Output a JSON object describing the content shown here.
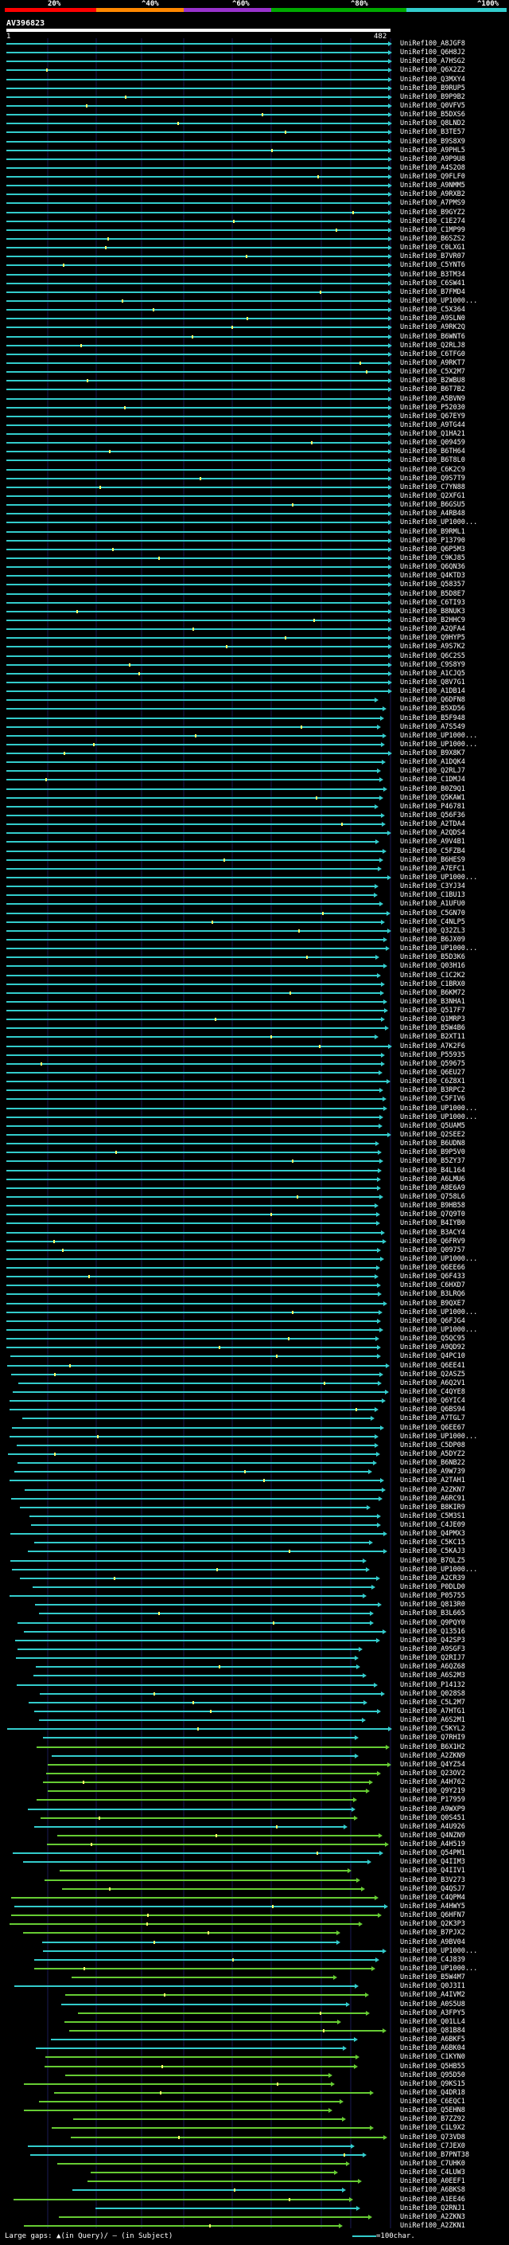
{
  "scale": {
    "ticks": [
      "20%",
      "^40%",
      "^60%",
      "^80%",
      "^100%"
    ],
    "segment_colors": [
      "#ff0000",
      "#ff8800",
      "#9933cc",
      "#00aa00",
      "#33cccc"
    ]
  },
  "query": {
    "id": "AV396823",
    "start": "1",
    "end": "482"
  },
  "hit_colors": {
    "cyan": "#33cccc",
    "green": "#66cc33"
  },
  "hits": [
    "UniRef100_A8JGF8",
    "UniRef100_Q6H8J2",
    "UniRef100_A7HSG2",
    "UniRef100_Q6X2Z2",
    "UniRef100_Q3MXY4",
    "UniRef100_B9RUP5",
    "UniRef100_B9P9B2",
    "UniRef100_Q0VFV5",
    "UniRef100_B5DXS6",
    "UniRef100_Q8LND2",
    "UniRef100_B3TE57",
    "UniRef100_B9S8X9",
    "UniRef100_A9PHL5",
    "UniRef100_A9P9U8",
    "UniRef100_A4S2O8",
    "UniRef100_Q9FLF0",
    "UniRef100_A9NMM5",
    "UniRef100_A9RXB2",
    "UniRef100_A7PMS9",
    "UniRef100_B9GYZ2",
    "UniRef100_C1E274",
    "UniRef100_C1MP99",
    "UniRef100_B6SZS2",
    "UniRef100_C0LXG1",
    "UniRef100_B7VR07",
    "UniRef100_C5YNT6",
    "UniRef100_B3TM34",
    "UniRef100_C6SW41",
    "UniRef100_B7FMD4",
    "UniRef100_UP1000...",
    "UniRef100_C5X364",
    "UniRef100_A9SLN0",
    "UniRef100_A9RK2Q",
    "UniRef100_B6WNT6",
    "UniRef100_Q2RLJ8",
    "UniRef100_C6TFG0",
    "UniRef100_A9RKT7",
    "UniRef100_C5X2M7",
    "UniRef100_B2WBU8",
    "UniRef100_B6T7B2",
    "UniRef100_A5BVN9",
    "UniRef100_P52030",
    "UniRef100_Q67EY9",
    "UniRef100_A9TG44",
    "UniRef100_Q1HA21",
    "UniRef100_Q09459",
    "UniRef100_B6TH64",
    "UniRef100_B6T8L0",
    "UniRef100_C6K2C9",
    "UniRef100_Q9S7T9",
    "UniRef100_C7YN88",
    "UniRef100_Q2XFG1",
    "UniRef100_B6GSU5",
    "UniRef100_A4RB48",
    "UniRef100_UP1000...",
    "UniRef100_B9RML1",
    "UniRef100_P13790",
    "UniRef100_Q6P5M3",
    "UniRef100_C9KJ85",
    "UniRef100_Q6QN36",
    "UniRef100_Q4KTD3",
    "UniRef100_Q58357",
    "UniRef100_B5D8E7",
    "UniRef100_C6TI93",
    "UniRef100_B8NUK3",
    "UniRef100_B2HHC9",
    "UniRef100_A2QFA4",
    "UniRef100_Q9HYP5",
    "UniRef100_A9S7K2",
    "UniRef100_Q6C2S5",
    "UniRef100_C9S8Y9",
    "UniRef100_A1CJQ5",
    "UniRef100_Q8V7G1",
    "UniRef100_A1DB14",
    "UniRef100_Q6DFN8",
    "UniRef100_B5XD56",
    "UniRef100_B5F948",
    "UniRef100_A7S549",
    "UniRef100_UP1000...",
    "UniRef100_UP1000...",
    "UniRef100_B9X8K7",
    "UniRef100_A1DQK4",
    "UniRef100_Q2RLJ7",
    "UniRef100_C1DMJ4",
    "UniRef100_B0Z9Q1",
    "UniRef100_Q5KAW1",
    "UniRef100_P46781",
    "UniRef100_Q56F36",
    "UniRef100_A2TDA4",
    "UniRef100_A2QDS4",
    "UniRef100_A9V4B1",
    "UniRef100_C5FZB4",
    "UniRef100_B6HES9",
    "UniRef100_A7EFC1",
    "UniRef100_UP1000...",
    "UniRef100_C3YJ34",
    "UniRef100_C1BU13",
    "UniRef100_A1UFU0",
    "UniRef100_C5GN70",
    "UniRef100_C4NLP5",
    "UniRef100_Q32ZL3",
    "UniRef100_B6JX09",
    "UniRef100_UP1000...",
    "UniRef100_B5D3K6",
    "UniRef100_Q03H16",
    "UniRef100_C1C2K2",
    "UniRef100_C1BRX0",
    "UniRef100_B6KM72",
    "UniRef100_B3NHA1",
    "UniRef100_Q517F7",
    "UniRef100_Q1MRP3",
    "UniRef100_B5W4B6",
    "UniRef100_B2XT11",
    "UniRef100_A7K2F6",
    "UniRef100_P55935",
    "UniRef100_Q59675",
    "UniRef100_Q6EU27",
    "UniRef100_C6Z8X1",
    "UniRef100_B3RPC2",
    "UniRef100_C5FIV6",
    "UniRef100_UP1000...",
    "UniRef100_UP1000...",
    "UniRef100_Q5UAM5",
    "UniRef100_Q2SEE2",
    "UniRef100_B6UDN8",
    "UniRef100_B9P5V0",
    "UniRef100_B5ZY37",
    "UniRef100_B4L164",
    "UniRef100_A6LMU6",
    "UniRef100_A8E6A9",
    "UniRef100_Q758L6",
    "UniRef100_B9HB58",
    "UniRef100_Q7Q9T0",
    "UniRef100_B4IYB0",
    "UniRef100_B3ACY4",
    "UniRef100_Q6FRV9",
    "UniRef100_Q09757",
    "UniRef100_UP1000...",
    "UniRef100_Q6EE66",
    "UniRef100_Q6F433",
    "UniRef100_C6HXD7",
    "UniRef100_B3LRQ6",
    "UniRef100_B9QXE7",
    "UniRef100_UP1000...",
    "UniRef100_Q6FJG4",
    "UniRef100_UP1000...",
    "UniRef100_Q5QC95",
    "UniRef100_A9QD92",
    "UniRef100_Q4PC10",
    "UniRef100_Q6EE41",
    "UniRef100_Q2ASZ5",
    "UniRef100_A6Q2V1",
    "UniRef100_C4QYE8",
    "UniRef100_Q6YIC4",
    "UniRef100_Q6BS94",
    "UniRef100_A7TGL7",
    "UniRef100_Q6EE67",
    "UniRef100_UP1000...",
    "UniRef100_C5DP08",
    "UniRef100_A5DYZ2",
    "UniRef100_B6NB22",
    "UniRef100_A9W739",
    "UniRef100_A2TAH1",
    "UniRef100_A2ZKN7",
    "UniRef100_A6RC91",
    "UniRef100_B8KIR9",
    "UniRef100_C5M3S1",
    "UniRef100_C4JE09",
    "UniRef100_Q4PMX3",
    "UniRef100_C5KC15",
    "UniRef100_C5KAJ3",
    "UniRef100_B7QLZ5",
    "UniRef100_UP1000...",
    "UniRef100_A2CR39",
    "UniRef100_P0DLD0",
    "UniRef100_P05755",
    "UniRef100_Q813R0",
    "UniRef100_B3L665",
    "UniRef100_Q9PQY0",
    "UniRef100_Q13516",
    "UniRef100_Q42SP3",
    "UniRef100_A9SGF3",
    "UniRef100_Q2RIJ7",
    "UniRef100_A6QZ68",
    "UniRef100_A6S2M3",
    "UniRef100_P14132",
    "UniRef100_Q028S8",
    "UniRef100_C5L2M7",
    "UniRef100_A7HTG1",
    "UniRef100_A6S2M1",
    "UniRef100_C5KYL2",
    "UniRef100_Q7RHI9",
    "UniRef100_B6X1H2",
    "UniRef100_A2ZKN9",
    "UniRef100_Q4YZ54",
    "UniRef100_Q23OV2",
    "UniRef100_A4H762",
    "UniRef100_Q9Y219",
    "UniRef100_P17959",
    "UniRef100_A9WXP9",
    "UniRef100_Q0S451",
    "UniRef100_A4U926",
    "UniRef100_Q4NZN9",
    "UniRef100_A4H519",
    "UniRef100_Q54PM1",
    "UniRef100_Q4IIM3",
    "UniRef100_Q4IIV1",
    "UniRef100_B3V273",
    "UniRef100_Q4QSJ7",
    "UniRef100_C4QPM4",
    "UniRef100_A4HWY5",
    "UniRef100_Q6HFN7",
    "UniRef100_Q2K3P3",
    "UniRef100_B7PJX2",
    "UniRef100_A9BV04",
    "UniRef100_UP1000...",
    "UniRef100_C4J839",
    "UniRef100_UP1000...",
    "UniRef100_B5W4M7",
    "UniRef100_Q0J3I1",
    "UniRef100_A4IVM2",
    "UniRef100_A0S5U8",
    "UniRef100_A3FPY5",
    "UniRef100_Q01LL4",
    "UniRef100_Q81B84",
    "UniRef100_A6BKF5",
    "UniRef100_A6BK04",
    "UniRef100_C1KYN0",
    "UniRef100_Q5HB55",
    "UniRef100_Q95D50",
    "UniRef100_Q9KS15",
    "UniRef100_Q4DR18",
    "UniRef100_C6EQC1",
    "UniRef100_Q5EHN8",
    "UniRef100_B7ZZ92",
    "UniRef100_C1L9X2",
    "UniRef100_Q73VD8",
    "UniRef100_C7JEX0",
    "UniRef100_B7PNT38",
    "UniRef100_C7UHK0",
    "UniRef100_C4LUW3",
    "UniRef100_A0EEF1",
    "UniRef100_A6BKS8",
    "UniRef100_A1EE46",
    "UniRef100_Q2RNJ1",
    "UniRef100_A2ZKN3",
    "UniRef100_A2ZKN1"
  ],
  "legend": {
    "left": "Large gaps: ▲(in Query)/ — (in Subject)",
    "right": "=100char."
  }
}
